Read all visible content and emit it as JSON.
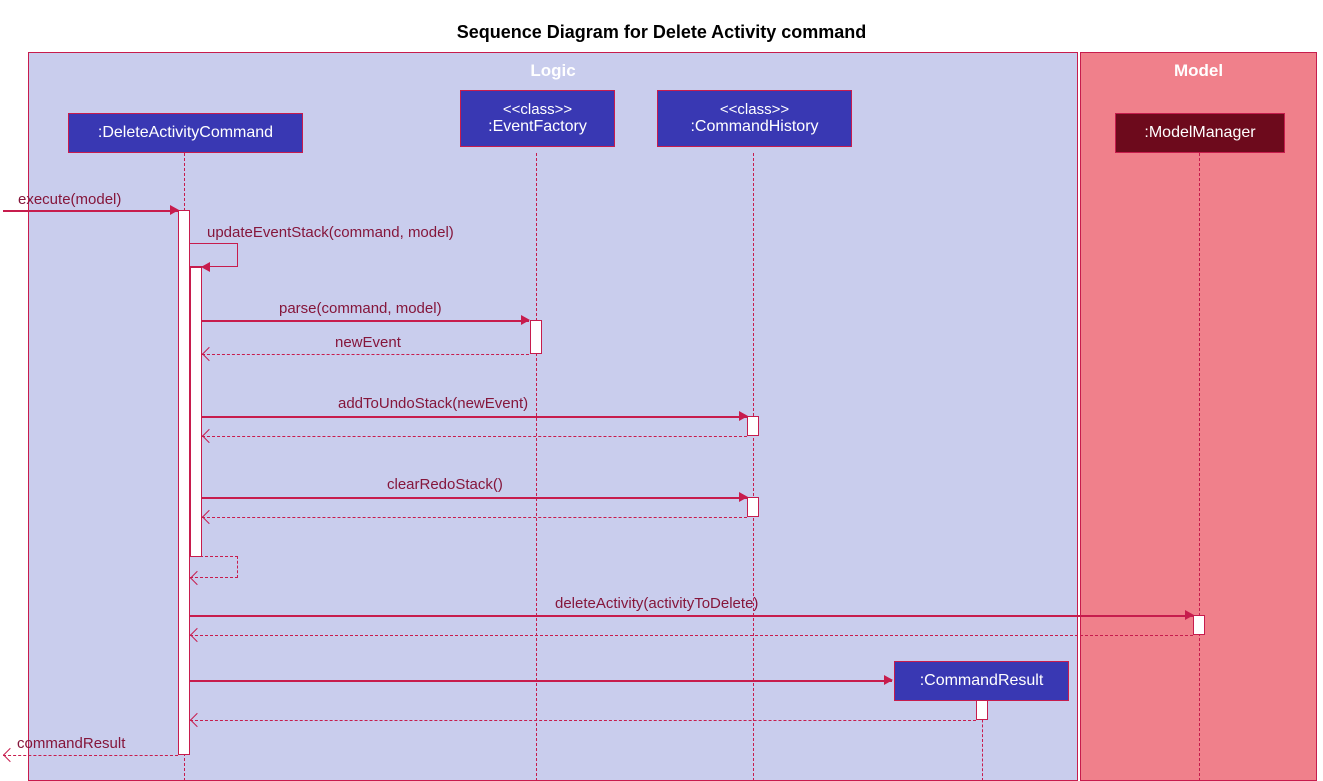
{
  "title": "Sequence Diagram for Delete Activity command",
  "boxes": {
    "logic": "Logic",
    "model": "Model"
  },
  "participants": {
    "dac": ":DeleteActivityCommand",
    "ef_stereo": "<<class>>",
    "ef": ":EventFactory",
    "ch_stereo": "<<class>>",
    "ch": ":CommandHistory",
    "mm": ":ModelManager",
    "cr": ":CommandResult"
  },
  "messages": {
    "execute": "execute(model)",
    "updateEventStack": "updateEventStack(command, model)",
    "parse": "parse(command, model)",
    "newEvent": "newEvent",
    "addToUndo": "addToUndoStack(newEvent)",
    "clearRedo": "clearRedoStack()",
    "deleteActivity": "deleteActivity(activityToDelete)",
    "commandResult": "commandResult"
  },
  "chart_data": {
    "type": "sequence_diagram",
    "title": "Sequence Diagram for Delete Activity command",
    "boxes": [
      {
        "name": "Logic",
        "participants": [
          "DeleteActivityCommand",
          "EventFactory",
          "CommandHistory",
          "CommandResult"
        ]
      },
      {
        "name": "Model",
        "participants": [
          "ModelManager"
        ]
      }
    ],
    "participants": [
      {
        "name": ":DeleteActivityCommand",
        "box": "Logic"
      },
      {
        "name": ":EventFactory",
        "stereotype": "<<class>>",
        "box": "Logic"
      },
      {
        "name": ":CommandHistory",
        "stereotype": "<<class>>",
        "box": "Logic"
      },
      {
        "name": ":ModelManager",
        "box": "Model"
      },
      {
        "name": ":CommandResult",
        "box": "Logic",
        "created": true
      }
    ],
    "messages": [
      {
        "from": "actor",
        "to": ":DeleteActivityCommand",
        "label": "execute(model)",
        "type": "sync"
      },
      {
        "from": ":DeleteActivityCommand",
        "to": ":DeleteActivityCommand",
        "label": "updateEventStack(command, model)",
        "type": "self"
      },
      {
        "from": ":DeleteActivityCommand",
        "to": ":EventFactory",
        "label": "parse(command, model)",
        "type": "sync"
      },
      {
        "from": ":EventFactory",
        "to": ":DeleteActivityCommand",
        "label": "newEvent",
        "type": "return"
      },
      {
        "from": ":DeleteActivityCommand",
        "to": ":CommandHistory",
        "label": "addToUndoStack(newEvent)",
        "type": "sync"
      },
      {
        "from": ":CommandHistory",
        "to": ":DeleteActivityCommand",
        "label": "",
        "type": "return"
      },
      {
        "from": ":DeleteActivityCommand",
        "to": ":CommandHistory",
        "label": "clearRedoStack()",
        "type": "sync"
      },
      {
        "from": ":CommandHistory",
        "to": ":DeleteActivityCommand",
        "label": "",
        "type": "return"
      },
      {
        "from": ":DeleteActivityCommand",
        "to": ":DeleteActivityCommand",
        "label": "",
        "type": "self-return"
      },
      {
        "from": ":DeleteActivityCommand",
        "to": ":ModelManager",
        "label": "deleteActivity(activityToDelete)",
        "type": "sync"
      },
      {
        "from": ":ModelManager",
        "to": ":DeleteActivityCommand",
        "label": "",
        "type": "return"
      },
      {
        "from": ":DeleteActivityCommand",
        "to": ":CommandResult",
        "label": "",
        "type": "create"
      },
      {
        "from": ":CommandResult",
        "to": ":DeleteActivityCommand",
        "label": "",
        "type": "return"
      },
      {
        "from": ":DeleteActivityCommand",
        "to": "actor",
        "label": "commandResult",
        "type": "return"
      }
    ]
  }
}
